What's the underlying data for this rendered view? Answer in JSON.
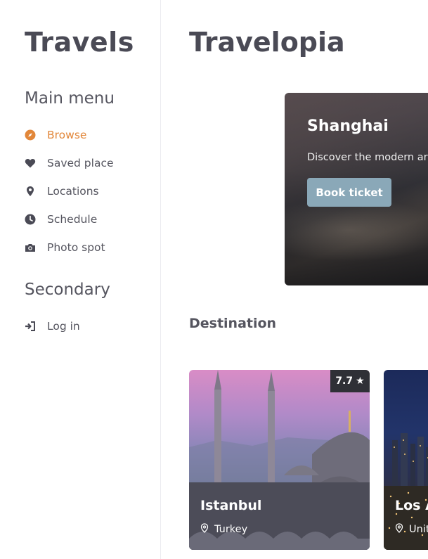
{
  "sidebar": {
    "brand": "Travels",
    "main_menu_title": "Main menu",
    "items": [
      {
        "label": "Browse",
        "icon": "compass-icon",
        "active": true
      },
      {
        "label": "Saved place",
        "icon": "heart-icon"
      },
      {
        "label": "Locations",
        "icon": "map-pin-icon"
      },
      {
        "label": "Schedule",
        "icon": "clock-icon"
      },
      {
        "label": "Photo spot",
        "icon": "camera-icon"
      }
    ],
    "secondary_title": "Secondary",
    "secondary_items": [
      {
        "label": "Log in",
        "icon": "sign-in-icon"
      }
    ]
  },
  "main": {
    "title": "Travelopia",
    "hero": {
      "title": "Shanghai",
      "description": "Discover the modern ar",
      "button_label": "Book ticket"
    },
    "section_title": "Destination",
    "destinations": [
      {
        "name": "Istanbul",
        "location": "Turkey",
        "rating": "7.7"
      },
      {
        "name": "Los A",
        "location": "Unit"
      }
    ]
  },
  "colors": {
    "accent": "#e2873a",
    "text": "#4a4a55",
    "button": "#8aa8b8",
    "rating_badge": "#2f3036"
  }
}
